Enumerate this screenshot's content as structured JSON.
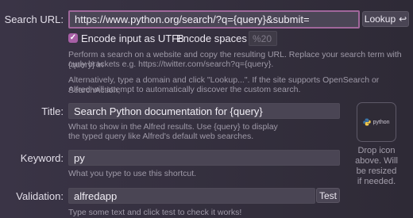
{
  "search_url": {
    "label": "Search URL:",
    "value": "https://www.python.org/search/?q={query}&submit=",
    "lookup_button": "Lookup",
    "lookup_icon": "return-arrow-icon"
  },
  "options": {
    "encode_utf8_label": "Encode input as UTF8",
    "encode_utf8_checked": true,
    "encode_spaces_label": "Encode spaces as",
    "encode_spaces_value": "%20"
  },
  "help": {
    "line1": "Perform a search on a website and copy the resulting URL. Replace your search term with {query} in",
    "line2": "curly brackets e.g. https://twitter.com/search?q={query}.",
    "line3": "Alternatively, type a domain and click \"Lookup...\". If the site supports OpenSearch or SearchAction,",
    "line4": "Alfred will attempt to automatically discover the custom search."
  },
  "title": {
    "label": "Title:",
    "value": "Search Python documentation for {query}",
    "help1": "What to show in the Alfred results. Use {query} to display",
    "help2": "the typed query like Alfred's default web searches."
  },
  "keyword": {
    "label": "Keyword:",
    "value": "py",
    "help": "What you type to use this shortcut."
  },
  "validation": {
    "label": "Validation:",
    "value": "alfredapp",
    "test_button": "Test",
    "help": "Type some text and click test to check it works!"
  },
  "icon_drop": {
    "icon_name": "python-logo-icon",
    "logo_text": "python",
    "caption1": "Drop icon",
    "caption2": "above. Will",
    "caption3": "be resized",
    "caption4": "if needed."
  }
}
